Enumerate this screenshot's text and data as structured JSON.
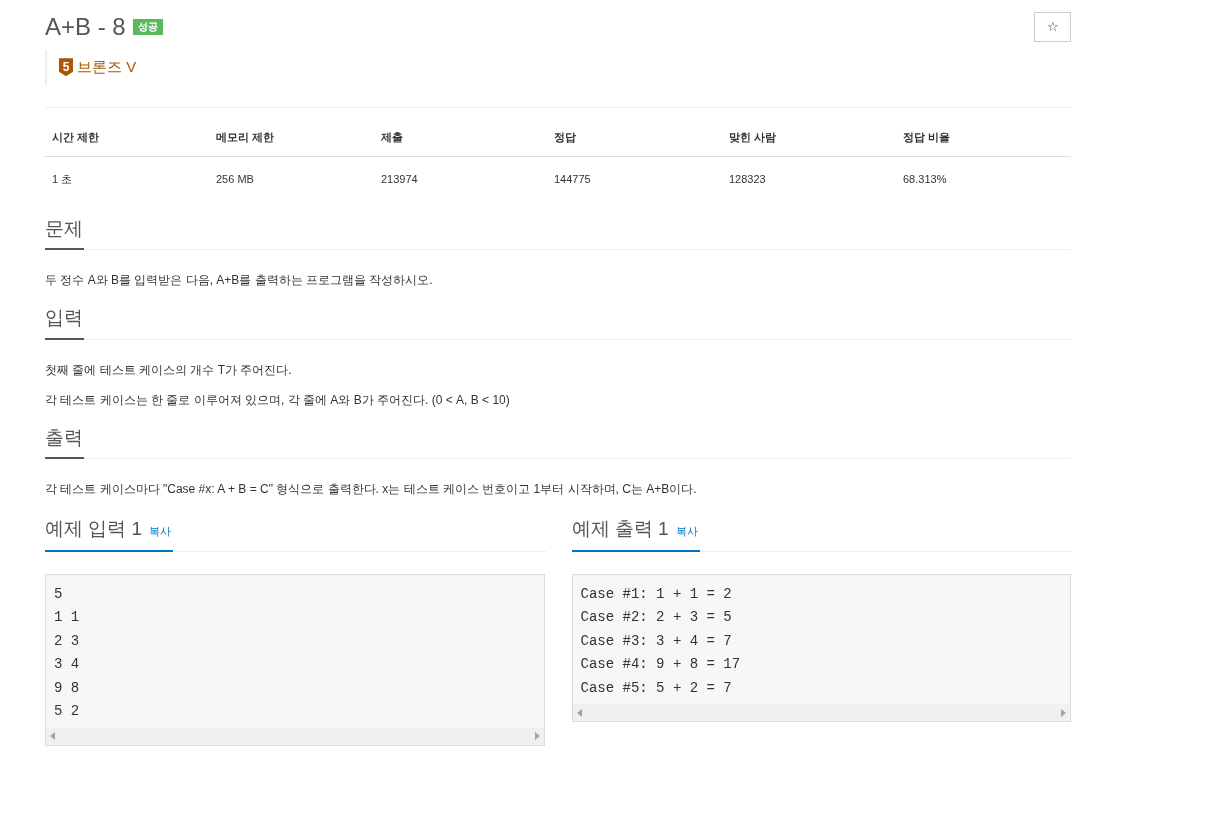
{
  "problem": {
    "title": "A+B - 8",
    "result_badge": {
      "label": "성공",
      "kind": "success"
    },
    "tier": {
      "number": "5",
      "label": "브론즈 V",
      "color": "#ad5600"
    },
    "star_button": "☆"
  },
  "stats": {
    "columns": [
      "시간 제한",
      "메모리 제한",
      "제출",
      "정답",
      "맞힌 사람",
      "정답 비율"
    ],
    "row": [
      "1 초",
      "256 MB",
      "213974",
      "144775",
      "128323",
      "68.313%"
    ]
  },
  "sections": [
    {
      "heading": "문제",
      "paragraphs": [
        "두 정수 A와 B를 입력받은 다음, A+B를 출력하는 프로그램을 작성하시오."
      ]
    },
    {
      "heading": "입력",
      "paragraphs": [
        "첫째 줄에 테스트 케이스의 개수 T가 주어진다.",
        "각 테스트 케이스는 한 줄로 이루어져 있으며, 각 줄에 A와 B가 주어진다. (0 < A, B < 10)"
      ]
    },
    {
      "heading": "출력",
      "paragraphs": [
        "각 테스트 케이스마다 \"Case #x: A + B = C\" 형식으로 출력한다. x는 테스트 케이스 번호이고 1부터 시작하며, C는 A+B이다."
      ]
    }
  ],
  "samples": [
    {
      "heading": "예제 입력 1",
      "copy": "복사",
      "lines": [
        "5",
        "1 1",
        "2 3",
        "3 4",
        "9 8",
        "5 2"
      ]
    },
    {
      "heading": "예제 출력 1",
      "copy": "복사",
      "lines": [
        "Case #1: 1 + 1 = 2",
        "Case #2: 2 + 3 = 5",
        "Case #3: 3 + 4 = 7",
        "Case #4: 9 + 8 = 17",
        "Case #5: 5 + 2 = 7"
      ]
    }
  ]
}
